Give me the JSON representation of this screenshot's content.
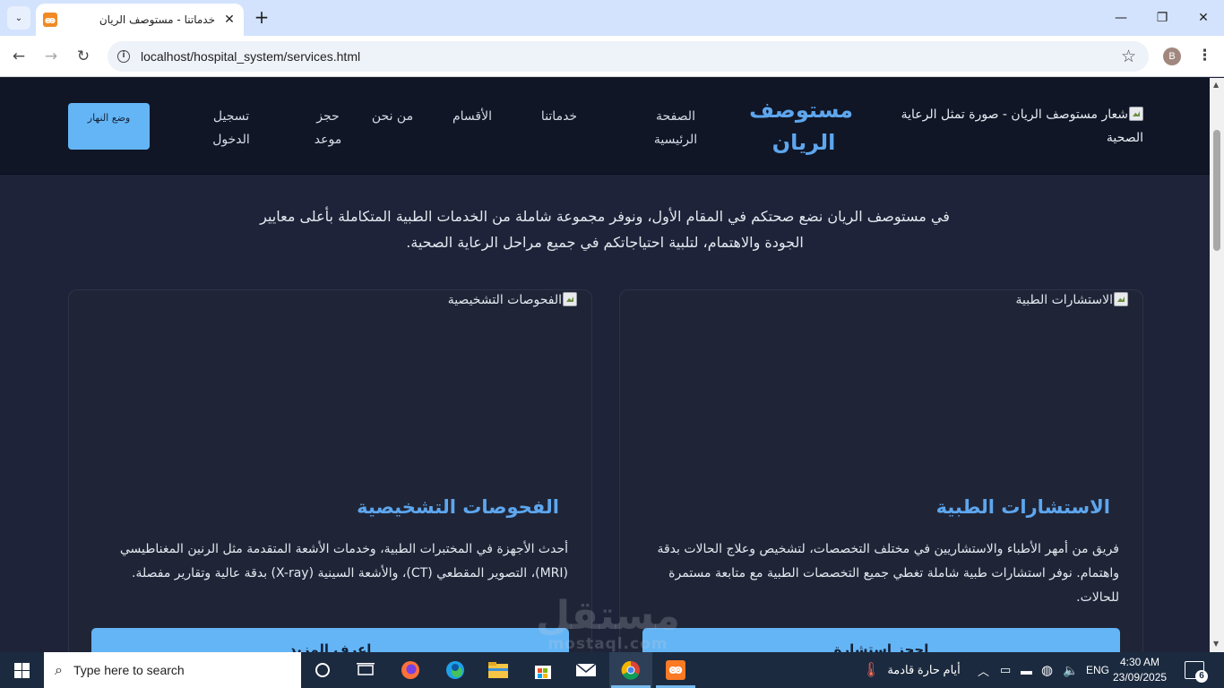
{
  "browser": {
    "tab": {
      "title": "خدماتنا - مستوصف الريان",
      "close": "✕"
    },
    "new_tab": "+",
    "tab_search": "⌄",
    "window_controls": {
      "minimize": "—",
      "restore": "❐",
      "close": "✕"
    },
    "nav": {
      "back": "←",
      "forward": "→",
      "reload": "↻"
    },
    "url": "localhost/hospital_system/services.html",
    "bookmark_star": "☆",
    "profile_initial": "B",
    "menu": "⋮"
  },
  "site": {
    "logo_alt": "شعار مستوصف الريان - صورة تمثل الرعاية الصحية",
    "brand_name": "مستوصف الريان",
    "nav": {
      "home": "الصفحة الرئيسية",
      "services": "خدماتنا",
      "departments": "الأقسام",
      "about": "من نحن",
      "booking": "حجز موعد",
      "login": "تسجيل الدخول"
    },
    "theme_toggle": "وضع النهار",
    "intro": "في مستوصف الريان نضع صحتكم في المقام الأول، ونوفر مجموعة شاملة من الخدمات الطبية المتكاملة بأعلى معايير الجودة والاهتمام، لتلبية احتياجاتكم في جميع مراحل الرعاية الصحية."
  },
  "cards": [
    {
      "image_alt": "الاستشارات الطبية",
      "title": "الاستشارات الطبية",
      "description": "فريق من أمهر الأطباء والاستشاريين في مختلف التخصصات، لتشخيص وعلاج الحالات بدقة واهتمام. نوفر استشارات طبية شاملة تغطي جميع التخصصات الطبية مع متابعة مستمرة للحالات.",
      "button": "احجز استشارة"
    },
    {
      "image_alt": "الفحوصات التشخيصية",
      "title": "الفحوصات التشخيصية",
      "description": "أحدث الأجهزة في المختبرات الطبية، وخدمات الأشعة المتقدمة مثل الرنين المغناطيسي (MRI)، التصوير المقطعي (CT)، والأشعة السينية (X-ray) بدقة عالية وتقارير مفصلة.",
      "button": "اعرف المزيد"
    }
  ],
  "watermark": {
    "arabic": "مستقل",
    "latin": "mostaql.com"
  },
  "taskbar": {
    "search_placeholder": "Type here to search",
    "weather_text": "أيام حارة قادمة",
    "language": "ENG",
    "time": "4:30 AM",
    "date": "23/09/2025",
    "notification_count": "6"
  }
}
